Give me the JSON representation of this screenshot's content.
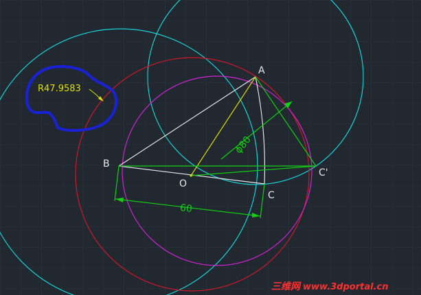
{
  "drawing": {
    "labels": {
      "A": "A",
      "B": "B",
      "C": "C",
      "C_prime": "C'",
      "O": "O"
    },
    "dimensions": {
      "radius": "R47.9583",
      "diameter": "ϕ80",
      "length": "60"
    },
    "colors": {
      "background": "#212830",
      "grid": "#2c3540",
      "cyan": "#19d2d8",
      "red": "#d1182a",
      "magenta": "#d024d4",
      "white": "#e8e8e8",
      "yellow": "#e0e000",
      "green": "#10d010",
      "markup_blue": "#1a22d8"
    }
  },
  "watermark": {
    "chinese": "三维网",
    "url": "www.3dportal.cn"
  }
}
